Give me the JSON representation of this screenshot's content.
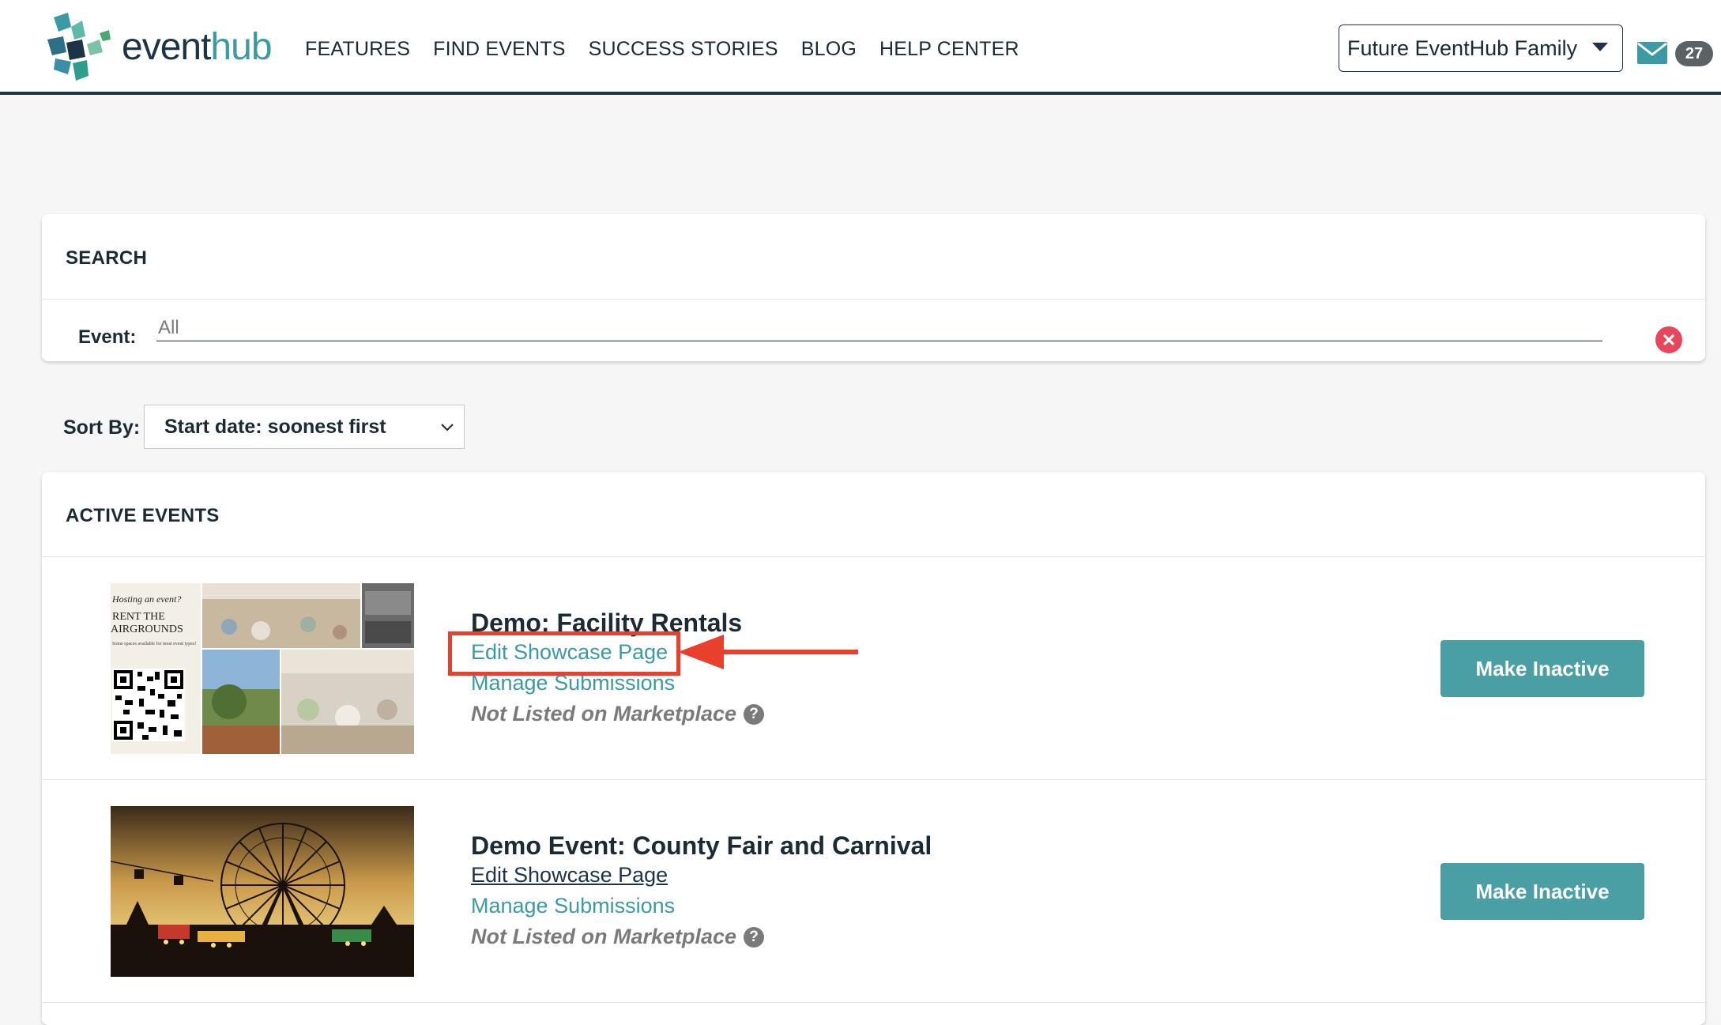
{
  "brand": {
    "name_part1": "event",
    "name_part2": "hub"
  },
  "nav": [
    {
      "label": "FEATURES"
    },
    {
      "label": "FIND EVENTS"
    },
    {
      "label": "SUCCESS STORIES"
    },
    {
      "label": "BLOG"
    },
    {
      "label": "HELP CENTER"
    }
  ],
  "account": {
    "selected": "Future EventHub Family"
  },
  "messages": {
    "count": "27"
  },
  "search": {
    "title": "SEARCH",
    "event_label": "Event:",
    "event_placeholder": "All"
  },
  "sort": {
    "label": "Sort By:",
    "selected": "Start date: soonest first"
  },
  "active_events": {
    "title": "ACTIVE EVENTS",
    "events": [
      {
        "title": "Demo: Facility Rentals",
        "edit_link": "Edit Showcase Page",
        "manage_link": "Manage Submissions",
        "status": "Not Listed on Marketplace",
        "button": "Make Inactive",
        "thumb_text": {
          "line1": "Hosting an event?",
          "line2": "RENT THE",
          "line3": "AIRGROUNDS",
          "line4": "Some spaces available for most event types!"
        }
      },
      {
        "title": "Demo Event: County Fair and Carnival",
        "edit_link": "Edit Showcase Page",
        "manage_link": "Manage Submissions",
        "status": "Not Listed on Marketplace",
        "button": "Make Inactive"
      }
    ]
  },
  "colors": {
    "accent": "#3b9aa3",
    "button": "#4a9fa5",
    "navy": "#1d3447",
    "annotation": "#e8402d",
    "clear": "#e8465a"
  },
  "icons": {
    "mail": "mail-icon",
    "clear": "clear-circle-icon",
    "help": "question-circle-icon",
    "caret": "caret-down-icon",
    "chevron": "chevron-down-icon"
  }
}
